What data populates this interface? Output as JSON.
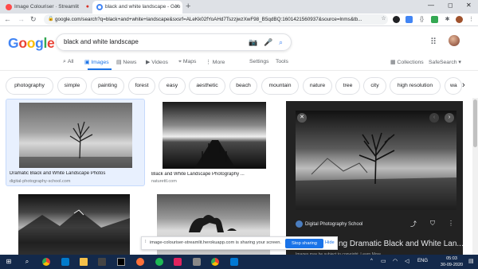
{
  "browser": {
    "tabs": [
      {
        "title": "Image Colouriser · Streamlit",
        "active": false
      },
      {
        "title": "black and white landscape - Goo",
        "active": true
      }
    ],
    "new_tab": "+",
    "window_controls": {
      "minimize": "—",
      "maximize": "◻",
      "close": "✕"
    },
    "url": "google.com/search?q=black+and+white+landscape&sxsrf=ALeKk02fYoAHd7TszzjwzXwF98_B5qdBQ:1601421560937&source=lnms&tb..."
  },
  "google": {
    "logo": [
      "G",
      "o",
      "o",
      "g",
      "l",
      "e"
    ],
    "logo_colors": [
      "#4285f4",
      "#ea4335",
      "#fbbc05",
      "#4285f4",
      "#34a853",
      "#ea4335"
    ],
    "query": "black and white landscape",
    "tabs": [
      {
        "label": "All",
        "icon": "search-icon"
      },
      {
        "label": "Images",
        "icon": "image-icon"
      },
      {
        "label": "News",
        "icon": "news-icon"
      },
      {
        "label": "Videos",
        "icon": "video-icon"
      },
      {
        "label": "Maps",
        "icon": "pin-icon"
      },
      {
        "label": "More",
        "icon": "more-icon"
      }
    ],
    "settings": "Settings",
    "tools": "Tools",
    "collections": "Collections",
    "safesearch": "SafeSearch",
    "chips": [
      "photography",
      "simple",
      "painting",
      "forest",
      "easy",
      "aesthetic",
      "beach",
      "mountain",
      "nature",
      "tree",
      "city",
      "high resolution",
      "wa"
    ]
  },
  "results": [
    {
      "title": "Dramatic Black and White Landscape Photos",
      "source": "digital-photography-school.com"
    },
    {
      "title": "Black and White Landscape Photography ...",
      "source": "naturettl.com"
    },
    {
      "title": "",
      "source": ""
    },
    {
      "title": "",
      "source": ""
    }
  ],
  "preview": {
    "source": "Digital Photography School",
    "title": "ng Dramatic Black and White Lan...",
    "caption": "Images may be subject to copyright. Learn More"
  },
  "share_bar": {
    "text": "image-colouriser-streamlit.herokuapp.com is sharing your screen.",
    "stop": "Stop sharing",
    "hide": "Hide"
  },
  "taskbar": {
    "lang": "ENG",
    "time": "05:03",
    "date": "30-09-2020"
  }
}
